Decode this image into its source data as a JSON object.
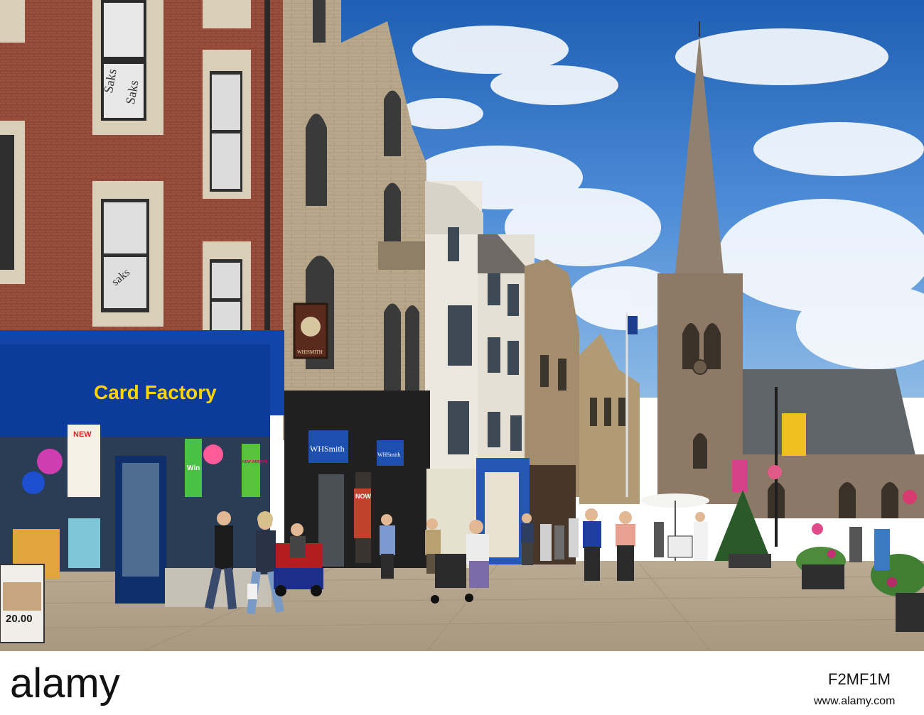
{
  "scene": {
    "description_label": "",
    "signs": {
      "card_factory": "Card Factory",
      "whsmith_left": "WHSmith",
      "whsmith_right": "WHSmith",
      "pub_sign": "WHISMITH",
      "saks_top": "Saks",
      "saks_middle": "Saks",
      "saks_lower": "saks",
      "poster_new": "NEW",
      "poster_new_website": "NEW WEBSITE",
      "poster_win": "Win",
      "ad_price": "20.00",
      "now_sign": "NOW"
    },
    "watermark": {
      "brand": "alamy",
      "image_id": "F2MF1M",
      "url": "www.alamy.com"
    }
  }
}
